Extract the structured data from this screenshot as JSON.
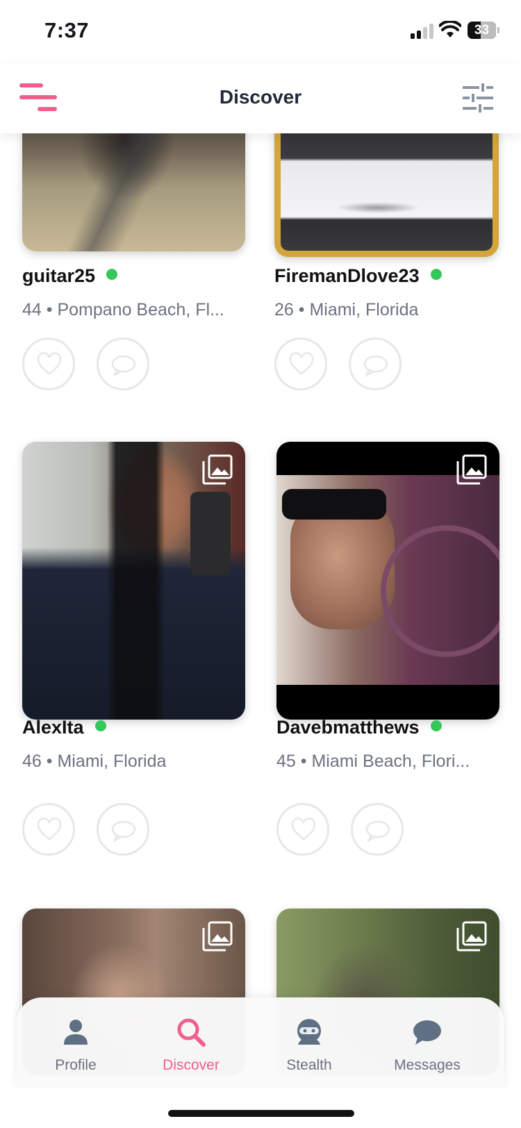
{
  "status_bar": {
    "time": "7:37",
    "battery": "33"
  },
  "header": {
    "title": "Discover",
    "menu_icon": "hamburger-menu-icon",
    "filter_icon": "sliders-icon"
  },
  "profiles": [
    {
      "username": "guitar25",
      "age": "44",
      "location": "Pompano Beach, Fl...",
      "meta": "44 • Pompano Beach, Fl...",
      "online": true,
      "featured": false
    },
    {
      "username": "FiremanDlove23",
      "age": "26",
      "location": "Miami, Florida",
      "meta": "26 • Miami, Florida",
      "online": true,
      "featured": true
    },
    {
      "username": "AlexIta",
      "age": "46",
      "location": "Miami, Florida",
      "meta": "46 • Miami, Florida",
      "online": true,
      "featured": false
    },
    {
      "username": "Davebmatthews",
      "age": "45",
      "location": "Miami Beach, Flori...",
      "meta": "45 • Miami Beach, Flori...",
      "online": true,
      "featured": false
    },
    {
      "username": "",
      "meta": "",
      "online": false,
      "featured": false
    },
    {
      "username": "",
      "meta": "",
      "online": false,
      "featured": false
    }
  ],
  "tabbar": {
    "tabs": [
      {
        "label": "Profile",
        "icon": "person-icon",
        "active": false
      },
      {
        "label": "Discover",
        "icon": "search-icon",
        "active": true
      },
      {
        "label": "Stealth",
        "icon": "ninja-icon",
        "active": false
      },
      {
        "label": "Messages",
        "icon": "chat-bubble-icon",
        "active": false
      }
    ]
  },
  "colors": {
    "accent": "#f05f8c",
    "online": "#34c759",
    "featured_border": "#d3a53a",
    "muted": "#6b7280"
  }
}
